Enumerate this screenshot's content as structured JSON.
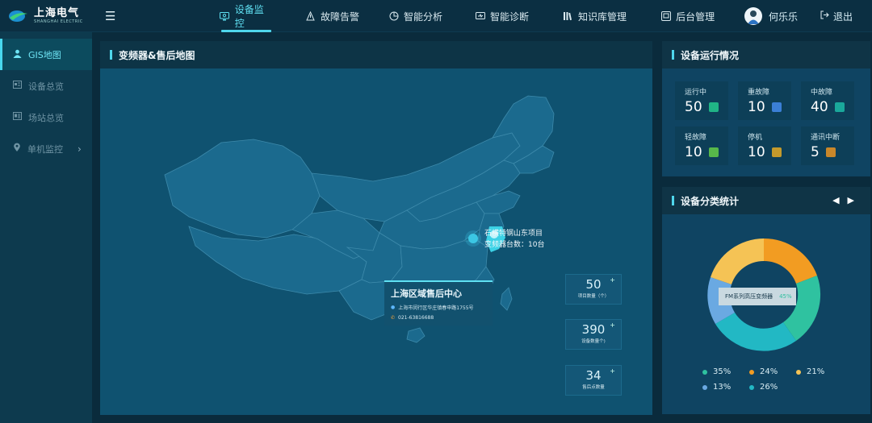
{
  "logo": {
    "cn": "上海电气",
    "en": "SHANGHAI ELECTRIC"
  },
  "nav": [
    {
      "label": "设备监控",
      "icon": "monitor-icon",
      "active": true
    },
    {
      "label": "故障告警",
      "icon": "alert-icon"
    },
    {
      "label": "智能分析",
      "icon": "analysis-icon"
    },
    {
      "label": "智能诊断",
      "icon": "diagnosis-icon"
    },
    {
      "label": "知识库管理",
      "icon": "book-icon"
    },
    {
      "label": "后台管理",
      "icon": "admin-icon"
    }
  ],
  "user": {
    "name": "何乐乐",
    "logout": "退出"
  },
  "sidebar": [
    {
      "label": "GIS地图",
      "icon": "user-icon",
      "active": true
    },
    {
      "label": "设备总览",
      "icon": "device-icon"
    },
    {
      "label": "场站总览",
      "icon": "station-icon"
    },
    {
      "label": "单机监控",
      "icon": "location-icon",
      "expandable": true
    }
  ],
  "map_panel": {
    "title": "变频器&售后地图",
    "project": {
      "name": "石横特钢山东项目",
      "count": "变频器台数：10台"
    },
    "center": {
      "title": "上海区域售后中心",
      "address": "上海市闵行区华庄镇春申路1755号",
      "phone": "021-63816688"
    },
    "stats": [
      {
        "value": "50",
        "caption": "项目数量（个）"
      },
      {
        "value": "390",
        "caption": "设备数量个)"
      },
      {
        "value": "34",
        "caption": "售后点数量"
      }
    ]
  },
  "status_panel": {
    "title": "设备运行情况",
    "items": [
      {
        "label": "运行中",
        "value": "50",
        "color": "#20b486"
      },
      {
        "label": "重故障",
        "value": "10",
        "color": "#3b7fd6"
      },
      {
        "label": "中故障",
        "value": "40",
        "color": "#1aa89b"
      },
      {
        "label": "轻故障",
        "value": "10",
        "color": "#57b84a"
      },
      {
        "label": "停机",
        "value": "10",
        "color": "#c49a2c"
      },
      {
        "label": "通讯中断",
        "value": "5",
        "color": "#c9872a"
      }
    ]
  },
  "class_panel": {
    "title": "设备分类统计",
    "prev": "◀",
    "next": "▶",
    "tooltip": {
      "name": "FM系列高压变频器",
      "pct": "45%"
    },
    "legend": [
      {
        "pct": "35%",
        "color": "#2fc2a0"
      },
      {
        "pct": "24%",
        "color": "#f29c22"
      },
      {
        "pct": "21%",
        "color": "#f5c355"
      },
      {
        "pct": "13%",
        "color": "#6aa9e2"
      },
      {
        "pct": "26%",
        "color": "#22b8c4"
      }
    ]
  }
}
